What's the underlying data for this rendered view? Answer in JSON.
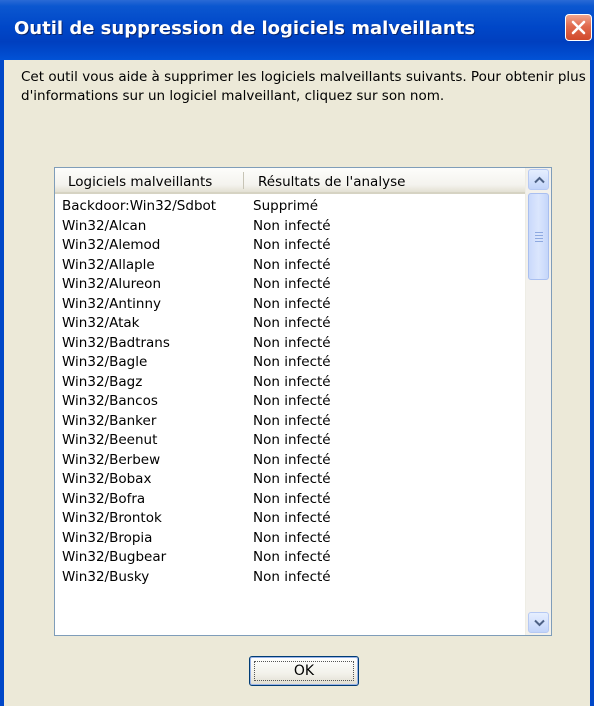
{
  "window": {
    "title": "Outil de suppression de logiciels malveillants",
    "close_icon": "close-icon",
    "titlebar_color": "#0047c8",
    "close_color": "#e16a4d"
  },
  "description": "Cet outil vous aide à supprimer les logiciels malveillants suivants. Pour obtenir plus d'informations sur un logiciel malveillant, cliquez sur son nom.",
  "listview": {
    "columns": [
      "Logiciels malveillants",
      "Résultats de l'analyse"
    ],
    "rows": [
      {
        "name": "Backdoor:Win32/Sdbot",
        "result": "Supprimé"
      },
      {
        "name": "Win32/Alcan",
        "result": "Non infecté"
      },
      {
        "name": "Win32/Alemod",
        "result": "Non infecté"
      },
      {
        "name": "Win32/Allaple",
        "result": "Non infecté"
      },
      {
        "name": "Win32/Alureon",
        "result": "Non infecté"
      },
      {
        "name": "Win32/Antinny",
        "result": "Non infecté"
      },
      {
        "name": "Win32/Atak",
        "result": "Non infecté"
      },
      {
        "name": "Win32/Badtrans",
        "result": "Non infecté"
      },
      {
        "name": "Win32/Bagle",
        "result": "Non infecté"
      },
      {
        "name": "Win32/Bagz",
        "result": "Non infecté"
      },
      {
        "name": "Win32/Bancos",
        "result": "Non infecté"
      },
      {
        "name": "Win32/Banker",
        "result": "Non infecté"
      },
      {
        "name": "Win32/Beenut",
        "result": "Non infecté"
      },
      {
        "name": "Win32/Berbew",
        "result": "Non infecté"
      },
      {
        "name": "Win32/Bobax",
        "result": "Non infecté"
      },
      {
        "name": "Win32/Bofra",
        "result": "Non infecté"
      },
      {
        "name": "Win32/Brontok",
        "result": "Non infecté"
      },
      {
        "name": "Win32/Bropia",
        "result": "Non infecté"
      },
      {
        "name": "Win32/Bugbear",
        "result": "Non infecté"
      },
      {
        "name": "Win32/Busky",
        "result": "Non infecté"
      }
    ],
    "scroll_icons": {
      "up": "chevron-up-icon",
      "down": "chevron-down-icon"
    }
  },
  "ok_label": "OK"
}
